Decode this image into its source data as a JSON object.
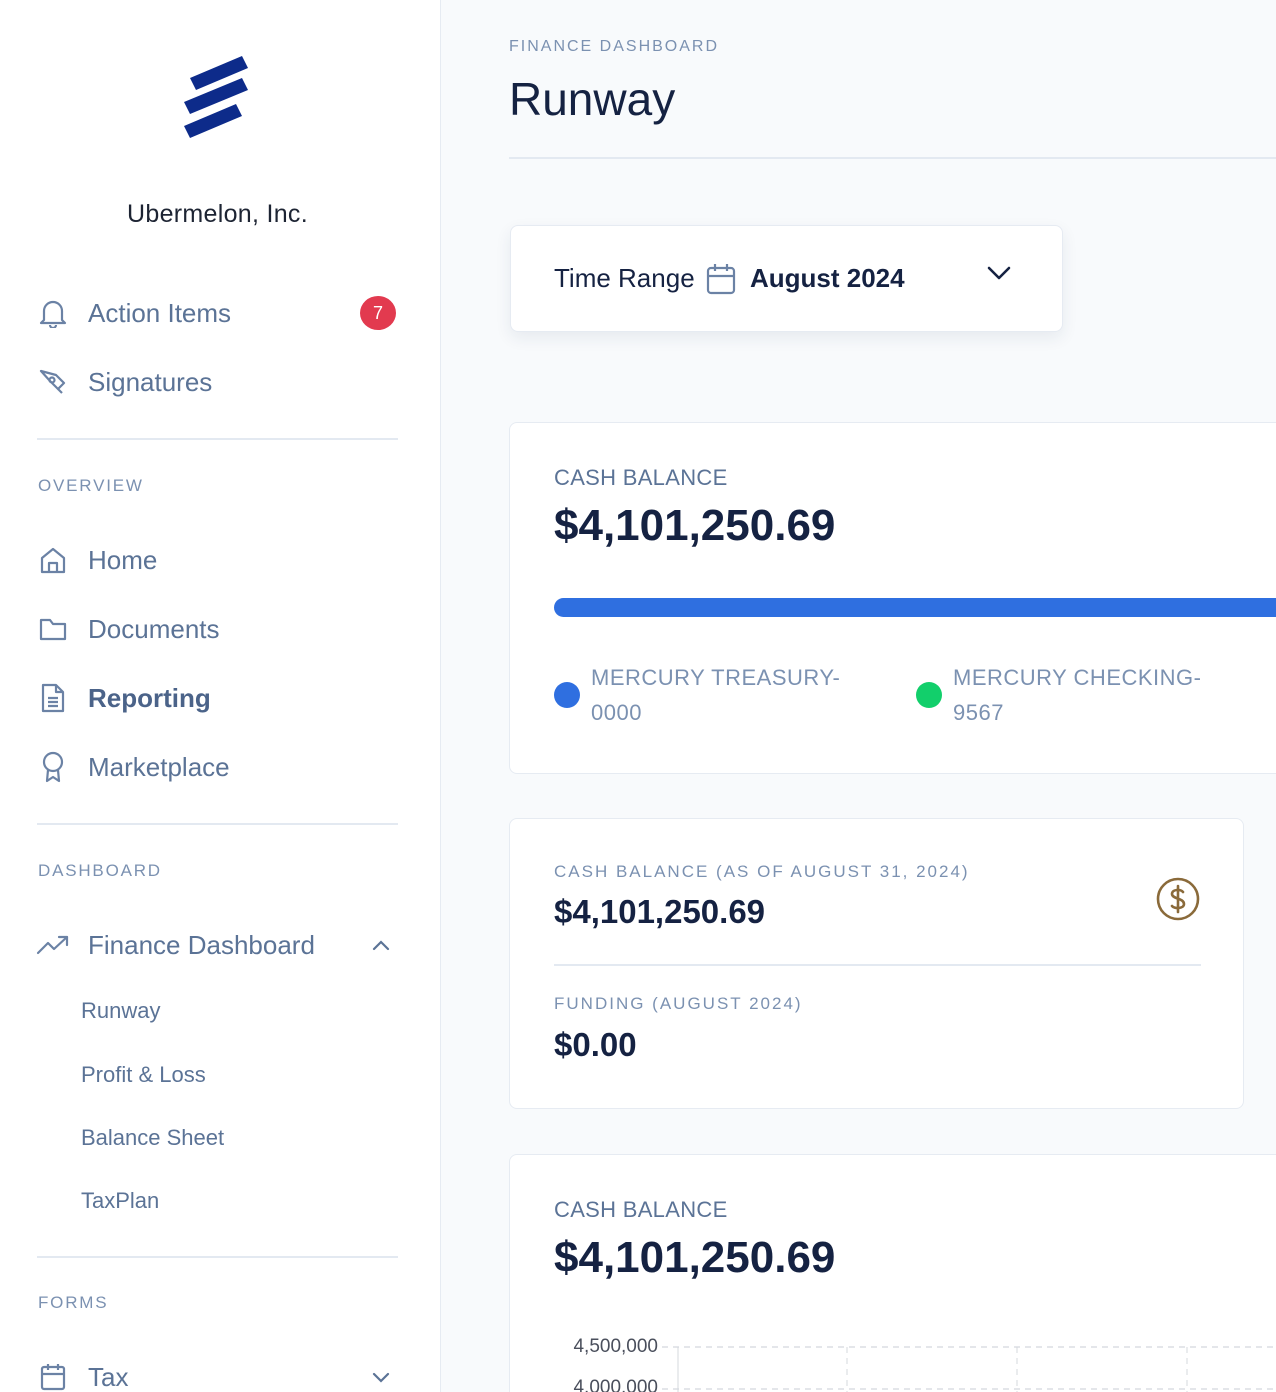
{
  "sidebar": {
    "company": "Ubermelon, Inc.",
    "action_items": {
      "label": "Action Items",
      "badge": "7"
    },
    "signatures": "Signatures",
    "overview_label": "OVERVIEW",
    "overview_items": [
      "Home",
      "Documents",
      "Reporting",
      "Marketplace"
    ],
    "dashboard_label": "DASHBOARD",
    "finance_dashboard": "Finance Dashboard",
    "finance_sub": [
      "Runway",
      "Profit & Loss",
      "Balance Sheet",
      "TaxPlan"
    ],
    "forms_label": "FORMS",
    "tax": "Tax"
  },
  "header": {
    "eyebrow": "FINANCE DASHBOARD",
    "title": "Runway"
  },
  "time_range": {
    "label": "Time Range",
    "value": "August 2024"
  },
  "cash_balance_card": {
    "caption": "CASH BALANCE",
    "amount": "$4,101,250.69",
    "accounts": [
      {
        "line1": "MERCURY TREASURY-",
        "line2": "0000",
        "color": "#2f6fe0"
      },
      {
        "line1": "MERCURY CHECKING-",
        "line2": "9567",
        "color": "#12cf6b"
      }
    ]
  },
  "summary_card": {
    "balance_caption": "CASH BALANCE (AS OF AUGUST 31, 2024)",
    "balance_amount": "$4,101,250.69",
    "funding_caption": "FUNDING (AUGUST 2024)",
    "funding_amount": "$0.00"
  },
  "chart_card": {
    "caption": "CASH BALANCE",
    "amount": "$4,101,250.69"
  },
  "chart_data": {
    "type": "line",
    "title": "",
    "xlabel": "",
    "ylabel": "",
    "y_ticks": [
      "4,500,000",
      "4,000,000"
    ],
    "series": [],
    "grid": true
  },
  "colors": {
    "accent": "#2f6fe0",
    "badge": "#e23a4f",
    "logo": "#0d2b8a",
    "dollar_icon": "#8a6a3a"
  }
}
